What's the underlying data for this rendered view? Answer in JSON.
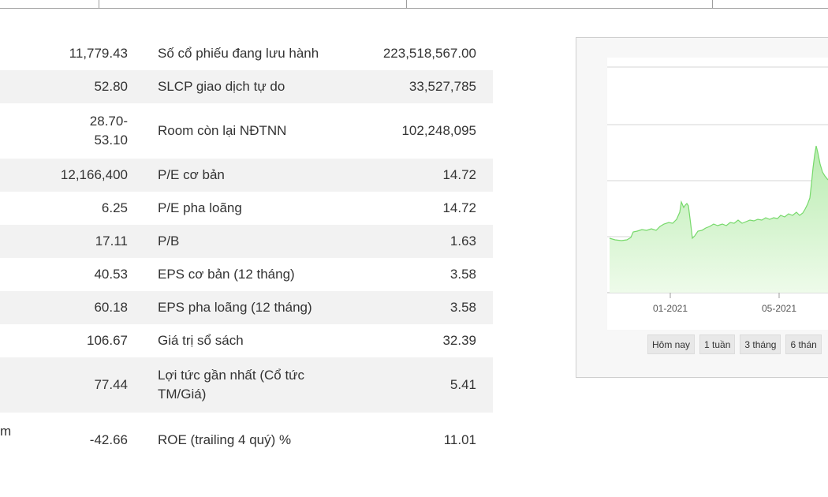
{
  "table": {
    "clipped_left_label": "m",
    "rows": [
      {
        "left_value": "11,779.43",
        "right_label": "Số cổ phiếu đang lưu hành",
        "right_value": "223,518,567.00"
      },
      {
        "left_value": "52.80",
        "right_label": "SLCP giao dịch tự do",
        "right_value": "33,527,785"
      },
      {
        "left_value": "28.70-\n53.10",
        "right_label": "Room còn lại NĐTNN",
        "right_value": "102,248,095"
      },
      {
        "left_value": "12,166,400",
        "right_label": "P/E cơ bản",
        "right_value": "14.72"
      },
      {
        "left_value": "6.25",
        "right_label": "P/E pha loãng",
        "right_value": "14.72"
      },
      {
        "left_value": "17.11",
        "right_label": "P/B",
        "right_value": "1.63"
      },
      {
        "left_value": "40.53",
        "right_label": "EPS cơ bản (12 tháng)",
        "right_value": "3.58"
      },
      {
        "left_value": "60.18",
        "right_label": "EPS pha loãng (12 tháng)",
        "right_value": "3.58"
      },
      {
        "left_value": "106.67",
        "right_label": "Giá trị sổ sách",
        "right_value": "32.39"
      },
      {
        "left_value": "77.44",
        "right_label": "Lợi tức gần nhất (Cổ tức TM/Giá)",
        "right_value": "5.41"
      },
      {
        "left_value": "-42.66",
        "right_label": "ROE (trailing 4 quý) %",
        "right_value": "11.01"
      }
    ]
  },
  "chart": {
    "x_tick_labels": [
      "01-2021",
      "05-2021"
    ],
    "range_buttons": [
      "Hôm nay",
      "1 tuần",
      "3 tháng",
      "6 thán"
    ],
    "colors": {
      "line": "#76d96a",
      "fill_top": "#b9ecb0",
      "fill_bottom": "#eefbea",
      "grid": "#d6d6d6"
    }
  }
}
